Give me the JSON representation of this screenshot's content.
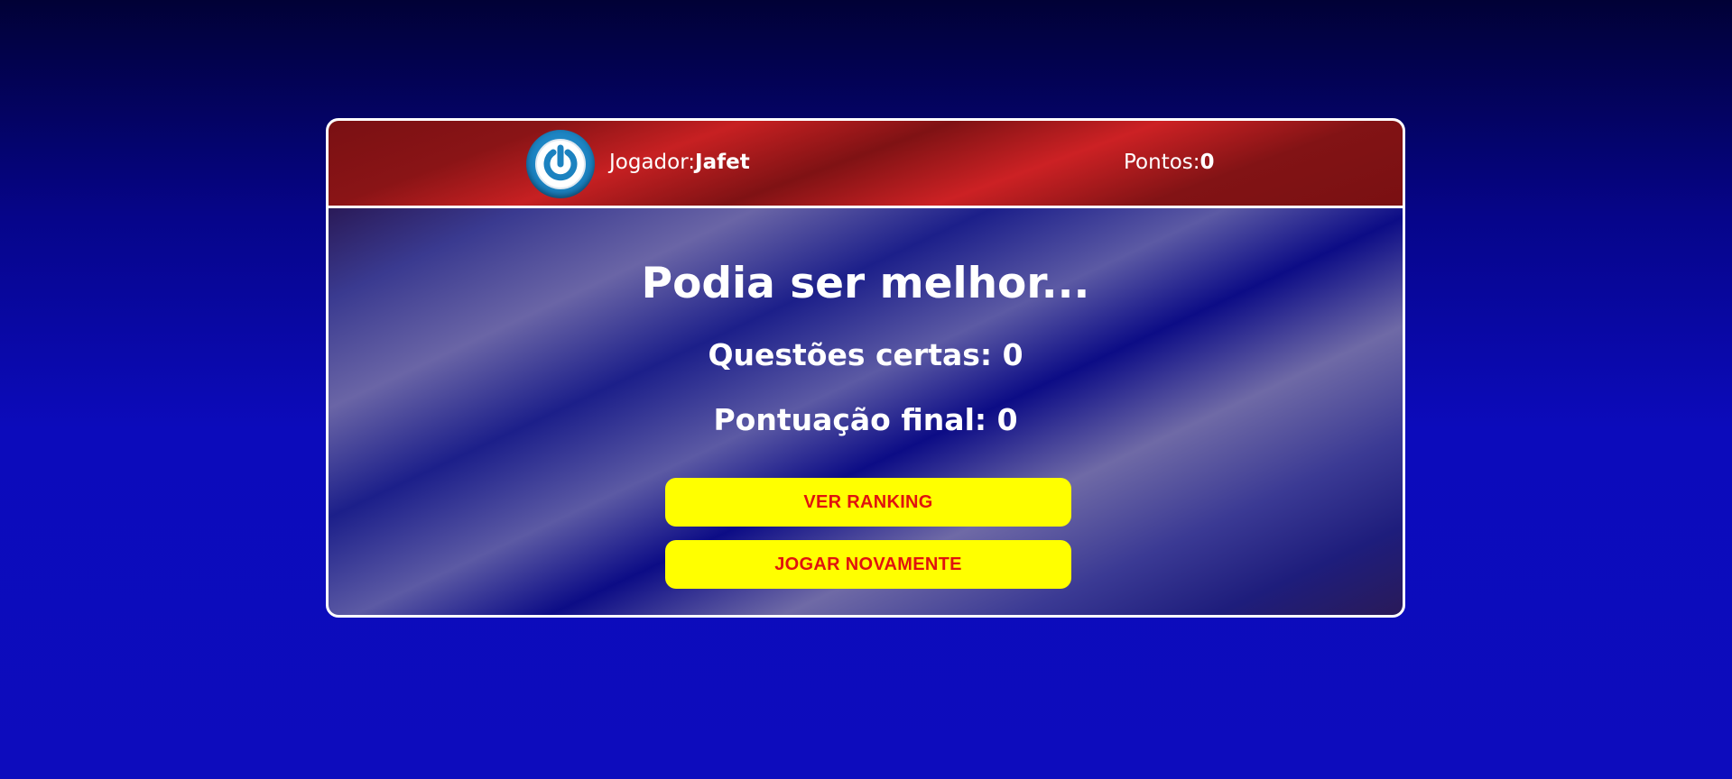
{
  "header": {
    "player_label": "Jogador:",
    "player_name": "Jafet",
    "points_label": "Pontos:",
    "points_value": "0",
    "logout_icon": "power-icon"
  },
  "result": {
    "title": "Podia ser melhor...",
    "correct_text": "Questões certas: 0",
    "final_score_text": "Pontuação final: 0"
  },
  "actions": {
    "ranking_label": "VER RANKING",
    "play_again_label": "JOGAR NOVAMENTE"
  },
  "colors": {
    "button_bg": "#ffff00",
    "button_text": "#e0120e",
    "header_red": "#c72022",
    "logout_blue": "#1c82c0"
  }
}
